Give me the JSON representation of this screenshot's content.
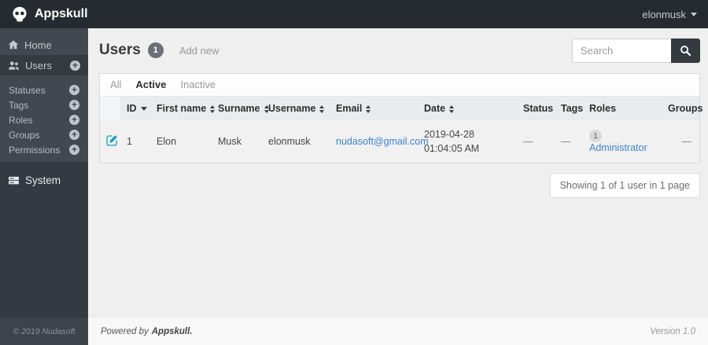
{
  "topbar": {
    "brand": "Appskull",
    "user_menu": "elonmusk"
  },
  "sidebar": {
    "home": "Home",
    "users": "Users",
    "submenu": [
      {
        "label": "Statuses"
      },
      {
        "label": "Tags"
      },
      {
        "label": "Roles"
      },
      {
        "label": "Groups"
      },
      {
        "label": "Permissions"
      }
    ],
    "system": "System",
    "copyright": "© 2019 Nudasoft"
  },
  "page": {
    "title": "Users",
    "count_badge": "1",
    "add_new": "Add new",
    "search_placeholder": "Search"
  },
  "tabs": [
    {
      "label": "All"
    },
    {
      "label": "Active"
    },
    {
      "label": "Inactive"
    }
  ],
  "table": {
    "columns": [
      {
        "label": ""
      },
      {
        "label": "ID"
      },
      {
        "label": "First name"
      },
      {
        "label": "Surname"
      },
      {
        "label": "Username"
      },
      {
        "label": "Email"
      },
      {
        "label": "Date"
      },
      {
        "label": "Status"
      },
      {
        "label": "Tags"
      },
      {
        "label": "Roles"
      },
      {
        "label": "Groups"
      }
    ],
    "row": {
      "id": "1",
      "first_name": "Elon",
      "surname": "Musk",
      "username": "elonmusk",
      "email": "nudasoft@gmail.com",
      "date_line1": "2019-04-28",
      "date_line2": "01:04:05 AM",
      "status": "—",
      "tags": "—",
      "roles_badge": "1",
      "roles_link": "Administrator",
      "groups": "—"
    }
  },
  "pagination": {
    "summary": "Showing 1 of 1 user in 1 page"
  },
  "footer": {
    "powered_by": "Powered by",
    "brand": "Appskull.",
    "version": "Version 1.0"
  },
  "colors": {
    "topbar_bg": "#262b31",
    "sidebar_bg": "#41484f",
    "link_blue": "#4183c4",
    "edit_teal": "#16a0b2",
    "header_bg": "#e9ebee",
    "row_bg": "#f1f1f2"
  }
}
